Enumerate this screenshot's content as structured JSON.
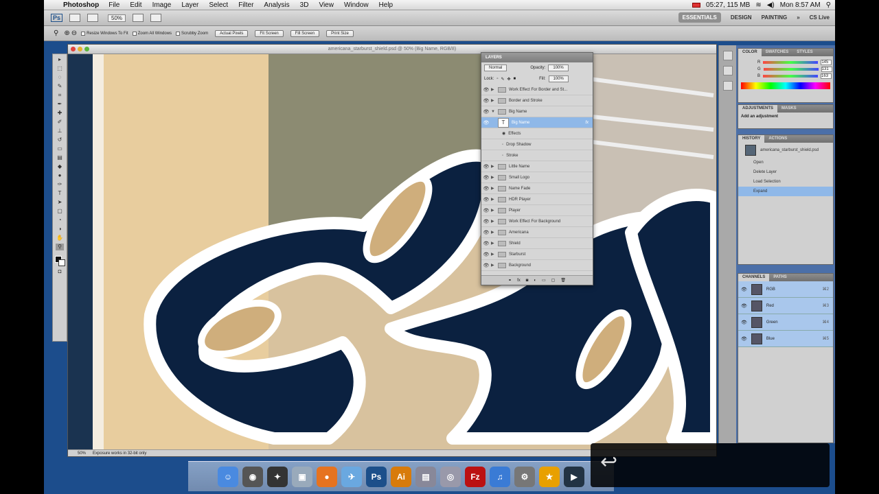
{
  "menubar": {
    "app": "Photoshop",
    "items": [
      "File",
      "Edit",
      "Image",
      "Layer",
      "Select",
      "Filter",
      "Analysis",
      "3D",
      "View",
      "Window",
      "Help"
    ],
    "status": "05:27, 115 MB",
    "clock": "Mon 8:57 AM"
  },
  "appbar": {
    "zoom": "50%",
    "workspaces": [
      "ESSENTIALS",
      "DESIGN",
      "PAINTING",
      "»"
    ],
    "cslive": "CS Live"
  },
  "options": {
    "checks": [
      "Resize Windows To Fit",
      "Zoom All Windows",
      "Scrubby Zoom"
    ],
    "buttons": [
      "Actual Pixels",
      "Fit Screen",
      "Fill Screen",
      "Print Size"
    ]
  },
  "document": {
    "title": "americana_starburst_shield.psd @ 50% (Big Name, RGB/8)",
    "zoom": "50%",
    "status": "Exposure works in 32-bit only"
  },
  "layers": {
    "tab": "LAYERS",
    "blend": "Normal",
    "opacity_label": "Opacity:",
    "opacity": "100%",
    "lock_label": "Lock:",
    "fill_label": "Fill:",
    "fill": "100%",
    "rows": [
      {
        "name": "Work Effect For Border and St...",
        "type": "group"
      },
      {
        "name": "Border and Stroke",
        "type": "group"
      },
      {
        "name": "Big Name",
        "type": "group-open"
      },
      {
        "name": "Big Name",
        "type": "text-selected",
        "fx": "fx"
      },
      {
        "name": "Effects",
        "type": "effects"
      },
      {
        "name": "Drop Shadow",
        "type": "effect"
      },
      {
        "name": "Stroke",
        "type": "effect"
      },
      {
        "name": "Little Name",
        "type": "group"
      },
      {
        "name": "Small Logo",
        "type": "group"
      },
      {
        "name": "Name Fade",
        "type": "group"
      },
      {
        "name": "HDR Player",
        "type": "group"
      },
      {
        "name": "Player",
        "type": "group"
      },
      {
        "name": "Work Effect For Background",
        "type": "group"
      },
      {
        "name": "Americana",
        "type": "group"
      },
      {
        "name": "Shield",
        "type": "group"
      },
      {
        "name": "Starburst",
        "type": "group"
      },
      {
        "name": "Background",
        "type": "group"
      }
    ]
  },
  "color_panel": {
    "tabs": [
      "COLOR",
      "SWATCHES",
      "STYLES"
    ],
    "sliders": [
      {
        "label": "R",
        "value": "145"
      },
      {
        "label": "G",
        "value": "131"
      },
      {
        "label": "B",
        "value": "163"
      }
    ]
  },
  "adjustments": {
    "tabs": [
      "ADJUSTMENTS",
      "MASKS"
    ],
    "hint": "Add an adjustment"
  },
  "history": {
    "tabs": [
      "HISTORY",
      "ACTIONS"
    ],
    "snapshot": "americana_starburst_shield.psd",
    "steps": [
      "Open",
      "Delete Layer",
      "Load Selection",
      "Expand"
    ]
  },
  "channels": {
    "tabs": [
      "CHANNELS",
      "PATHS"
    ],
    "rows": [
      {
        "name": "RGB",
        "sc": "⌘2"
      },
      {
        "name": "Red",
        "sc": "⌘3"
      },
      {
        "name": "Green",
        "sc": "⌘4"
      },
      {
        "name": "Blue",
        "sc": "⌘5"
      }
    ]
  },
  "dock": {
    "apps": [
      {
        "name": "finder",
        "glyph": "☺",
        "color": "#4a8ae0"
      },
      {
        "name": "dashboard",
        "glyph": "◉",
        "color": "#555"
      },
      {
        "name": "exposé",
        "glyph": "✦",
        "color": "#333"
      },
      {
        "name": "preview",
        "glyph": "▣",
        "color": "#9ab"
      },
      {
        "name": "firefox",
        "glyph": "●",
        "color": "#e67320"
      },
      {
        "name": "mail",
        "glyph": "✈",
        "color": "#6aa8e0"
      },
      {
        "name": "photoshop",
        "glyph": "Ps",
        "color": "#1c4f8a"
      },
      {
        "name": "illustrator",
        "glyph": "Ai",
        "color": "#d87b0b"
      },
      {
        "name": "iphoto",
        "glyph": "▤",
        "color": "#889"
      },
      {
        "name": "network",
        "glyph": "◎",
        "color": "#99a"
      },
      {
        "name": "filezilla",
        "glyph": "Fz",
        "color": "#b11"
      },
      {
        "name": "itunes",
        "glyph": "♫",
        "color": "#3a7bd5"
      },
      {
        "name": "system-preferences",
        "glyph": "⚙",
        "color": "#777"
      },
      {
        "name": "sprint",
        "glyph": "★",
        "color": "#e8a000"
      },
      {
        "name": "clapper",
        "glyph": "▶",
        "color": "#234"
      }
    ]
  },
  "overlay": {
    "icon": "↩"
  },
  "colors": {
    "navy": "#0b2140",
    "tan": "#e6c898",
    "accent": "#8fb8e8"
  }
}
